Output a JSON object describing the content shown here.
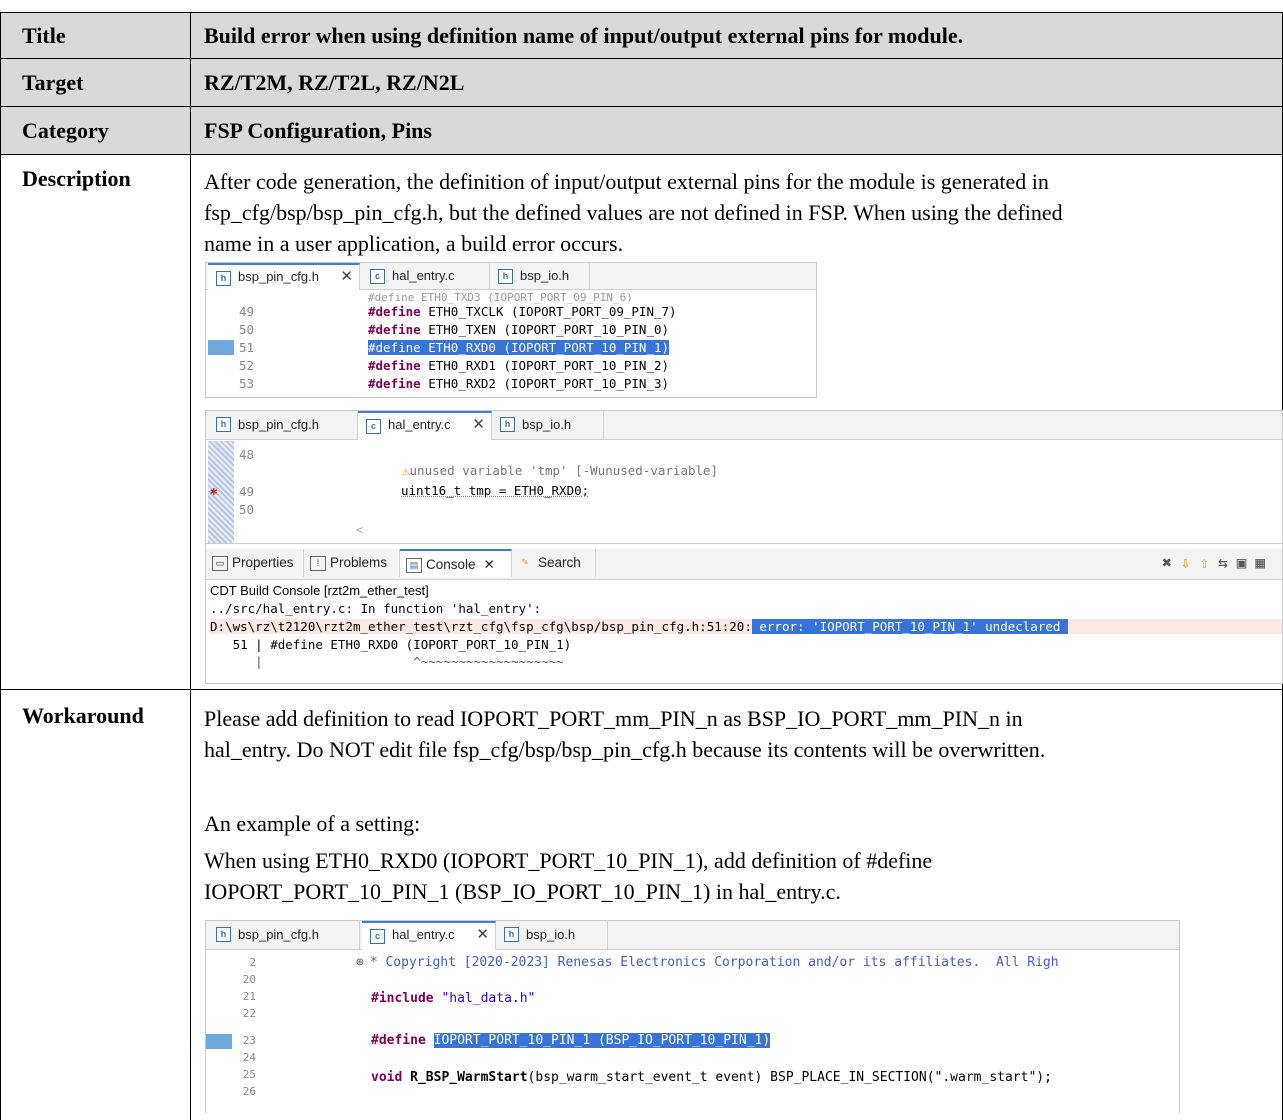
{
  "rows": {
    "title": {
      "label": "Title",
      "value": "Build error when using definition name of input/output external pins for module."
    },
    "target": {
      "label": "Target",
      "value": "RZ/T2M, RZ/T2L, RZ/N2L"
    },
    "category": {
      "label": "Category",
      "value": "FSP Configuration, Pins"
    },
    "description": {
      "label": "Description",
      "line1": "After code generation, the definition of input/output external pins for the module is generated in",
      "line2": "fsp_cfg/bsp/bsp_pin_cfg.h, but the defined values are not defined in FSP. When using the defined",
      "line3": "name in a user application, a build error occurs."
    },
    "workaround": {
      "label": "Workaround",
      "line1": "Please add definition to read IOPORT_PORT_mm_PIN_n as BSP_IO_PORT_mm_PIN_n in",
      "line2": "hal_entry. Do NOT edit file fsp_cfg/bsp/bsp_pin_cfg.h because its contents will be overwritten.",
      "line3": "An example of a setting:",
      "line4": "When using ETH0_RXD0 (IOPORT_PORT_10_PIN_1), add definition of  #define",
      "line5": "IOPORT_PORT_10_PIN_1 (BSP_IO_PORT_10_PIN_1) in hal_entry.c."
    }
  },
  "shot1": {
    "tabs": [
      "bsp_pin_cfg.h",
      "hal_entry.c",
      "bsp_io.h"
    ],
    "lines": [
      {
        "n": "49",
        "kw": "#define",
        "rest": " ETH0_TXCLK (IOPORT_PORT_09_PIN_7)"
      },
      {
        "n": "50",
        "kw": "#define",
        "rest": " ETH0_TXEN (IOPORT_PORT_10_PIN_0)"
      },
      {
        "n": "51",
        "kw": "#define",
        "rest": " ETH0_RXD0 (IOPORT_PORT_10_PIN_1)"
      },
      {
        "n": "52",
        "kw": "#define",
        "rest": " ETH0_RXD1 (IOPORT_PORT_10_PIN_2)"
      },
      {
        "n": "53",
        "kw": "#define",
        "rest": " ETH0_RXD2 (IOPORT_PORT_10_PIN_3)"
      }
    ]
  },
  "shot2": {
    "tabs": [
      "bsp_pin_cfg.h",
      "hal_entry.c",
      "bsp_io.h"
    ],
    "n48": "48",
    "n49": "49",
    "n50": "50",
    "warning": "unused variable 'tmp' [-Wunused-variable]",
    "code": "uint16_t tmp = ETH0_RXD0;",
    "views": [
      "Properties",
      "Problems",
      "Console",
      "Search"
    ],
    "console_title": "CDT Build Console [rzt2m_ether_test]",
    "c1": "../src/hal_entry.c: In function 'hal_entry':",
    "c2a": "D:\\ws\\rz\\t2120\\rzt2m_ether_test\\rzt_cfg\\fsp_cfg\\bsp/bsp_pin_cfg.h:51:20:",
    "c2b": " error: 'IOPORT_PORT_10_PIN_1' undeclared ",
    "c3": "   51 | #define ETH0_RXD0 (IOPORT_PORT_10_PIN_1)",
    "c4": "      |                    ^~~~~~~~~~~~~~~~~~~~"
  },
  "shot3": {
    "tabs": [
      "bsp_pin_cfg.h",
      "hal_entry.c",
      "bsp_io.h"
    ],
    "copyright": "* Copyright [2020-2023] Renesas Electronics Corporation and/or its affiliates.  All Righ",
    "include": "\"hal_data.h\"",
    "define_body": "IOPORT_PORT_10_PIN_1 (BSP_IO_PORT_10_PIN_1)",
    "warmstart": "(bsp_warm_start_event_t event) BSP_PLACE_IN_SECTION(\".warm_start\");",
    "nums": [
      "2",
      "20",
      "21",
      "22",
      "23",
      "24",
      "25",
      "26"
    ]
  }
}
